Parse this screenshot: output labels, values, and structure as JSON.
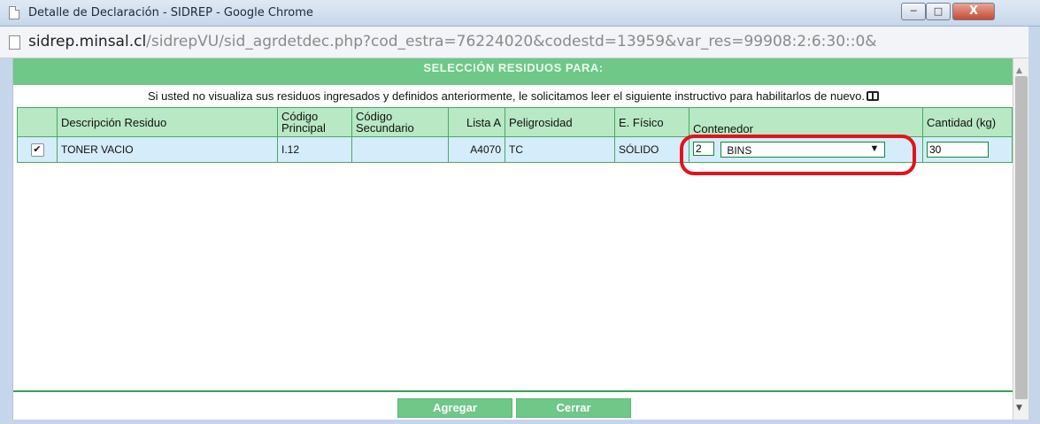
{
  "window": {
    "title": "Detalle de Declaración - SIDREP - Google Chrome",
    "min_label": "─",
    "max_label": "□",
    "close_label": "X"
  },
  "address": {
    "host": "sidrep.minsal.cl",
    "path": "/sidrepVU/sid_agrdetdec.php?cod_estra=76224020&codestd=13959&var_res=99908:2:6:30::0&"
  },
  "header": {
    "title": "SELECCIÓN RESIDUOS PARA:"
  },
  "notice": {
    "text": "Si usted no visualiza sus residuos ingresados y definidos anteriormente, le solicitamos leer el siguiente instructivo para habilitarlos de nuevo."
  },
  "table": {
    "columns": {
      "descripcion": "Descripción Residuo",
      "codigo_principal": "Código Principal",
      "codigo_secundario": "Código Secundario",
      "lista_a": "Lista A",
      "peligrosidad": "Peligrosidad",
      "e_fisico": "E. Físico",
      "contenedor": "Contenedor",
      "cantidad": "Cantidad (kg)"
    },
    "row": {
      "checked": "✔",
      "descripcion": "TONER VACIO",
      "codigo_principal": "I.12",
      "codigo_secundario": "",
      "lista_a": "A4070",
      "peligrosidad": "TC",
      "e_fisico": "SÓLIDO",
      "contenedor_qty": "2",
      "contenedor_tipo": "BINS",
      "cantidad": "30"
    }
  },
  "buttons": {
    "agregar": "Agregar",
    "cerrar": "Cerrar"
  },
  "icons": {
    "scroll_up": "▲",
    "scroll_down": "▼",
    "dropdown_caret": "▼"
  },
  "colors": {
    "accent_green": "#6fc788",
    "header_cell": "#b8e8c4",
    "row_bg": "#d5ecfa",
    "annotation_red": "#e0151b"
  }
}
